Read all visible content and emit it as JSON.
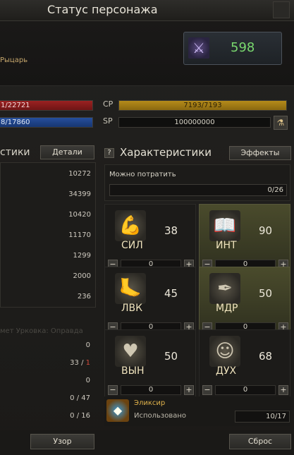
{
  "window": {
    "title": "Статус персонажа"
  },
  "character": {
    "class_name": "Рыцарь",
    "cp_value": "598"
  },
  "bars": {
    "hp_text": "1/22721",
    "mp_text": "8/17860",
    "cp_label": "CP",
    "cp_text": "7193/7193",
    "sp_label": "SP",
    "sp_text": "100000000"
  },
  "left_panel": {
    "title": "стики",
    "details_button": "Детали",
    "values": [
      "10272",
      "34399",
      "10420",
      "11170",
      "1299",
      "2000",
      "236"
    ],
    "faded_text": "мет Урковка: Оправда",
    "lower_values": [
      {
        "a": "0",
        "b": ""
      },
      {
        "a": "33",
        "b": "1"
      },
      {
        "a": "0",
        "b": ""
      },
      {
        "a": "0",
        "b": "47"
      },
      {
        "a": "0",
        "b": "16"
      }
    ],
    "footer_button": "Узор"
  },
  "right_panel": {
    "help_glyph": "?",
    "title": "Характеристики",
    "effects_button": "Эффекты",
    "spend_label": "Можно потратить",
    "spend_value": "0/26",
    "stats": [
      {
        "name": "СИЛ",
        "value": "38",
        "alloc": "0",
        "icon": "arm-icon",
        "active": false
      },
      {
        "name": "ИНТ",
        "value": "90",
        "alloc": "0",
        "icon": "book-icon",
        "active": true
      },
      {
        "name": "ЛВК",
        "value": "45",
        "alloc": "0",
        "icon": "foot-icon",
        "active": false
      },
      {
        "name": "МДР",
        "value": "50",
        "alloc": "0",
        "icon": "quill-icon",
        "active": true
      },
      {
        "name": "ВЫН",
        "value": "50",
        "alloc": "0",
        "icon": "heart-icon",
        "active": false
      },
      {
        "name": "ДУХ",
        "value": "68",
        "alloc": "0",
        "icon": "spirit-head-icon",
        "active": false
      }
    ],
    "elixir": {
      "name": "Эликсир",
      "used_label": "Использовано",
      "count": "10/17"
    },
    "footer_button": "Сброс"
  }
}
